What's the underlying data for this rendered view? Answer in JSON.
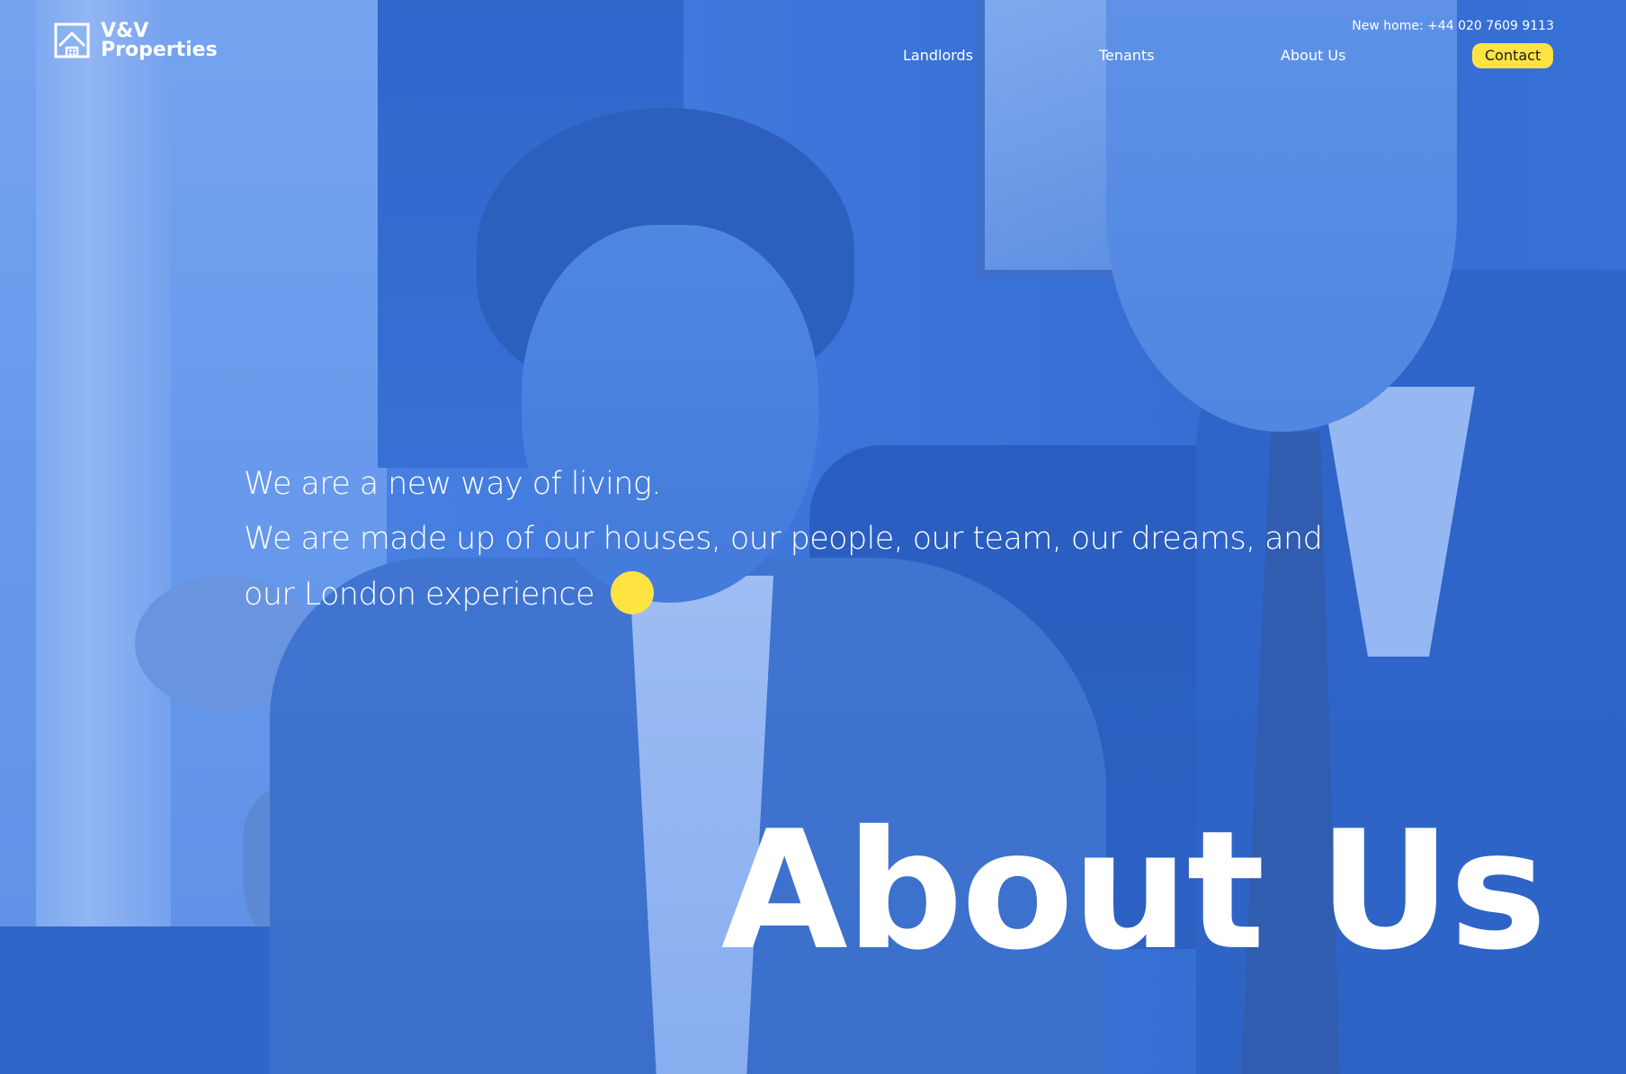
{
  "brand": {
    "name_line1": "V&V",
    "name_line2": "Properties",
    "logo_icon": "house-frame-icon"
  },
  "header": {
    "phone_text": "New home: +44 020 7609 9113"
  },
  "nav": {
    "items": [
      {
        "label": "Landlords"
      },
      {
        "label": "Tenants"
      },
      {
        "label": "About Us"
      }
    ],
    "contact_label": "Contact"
  },
  "hero": {
    "intro_line1": "We are a new way of living.",
    "intro_line2": "We are made up of our houses, our people, our team, our dreams, and our London experience",
    "heading": "About Us"
  },
  "colors": {
    "overlay_blue": "#3f76d6",
    "accent_yellow": "#ffe343",
    "text": "#ffffff"
  }
}
